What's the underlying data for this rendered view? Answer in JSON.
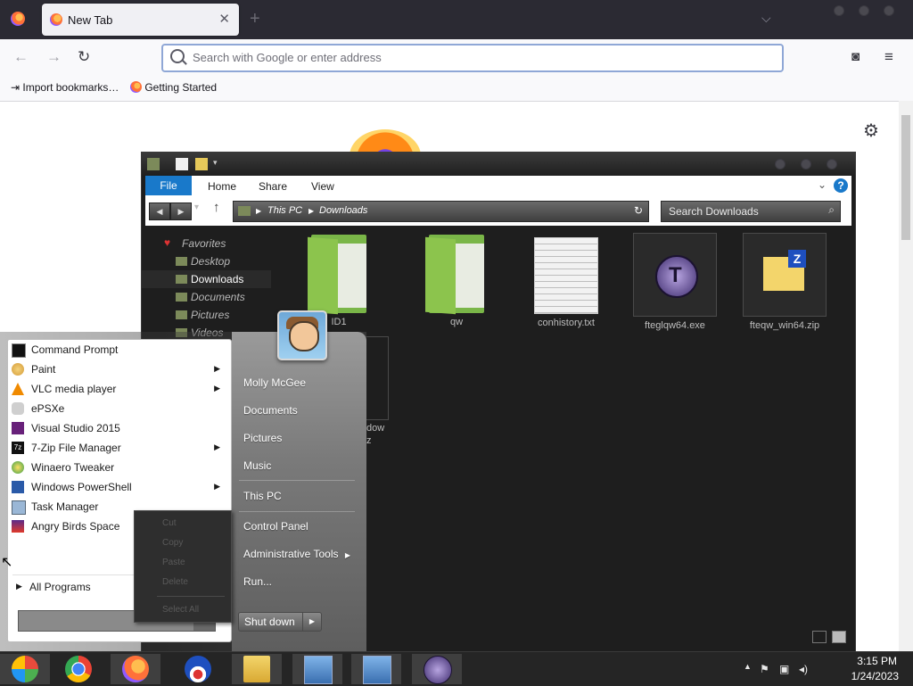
{
  "browser": {
    "tab_title": "New Tab",
    "address_placeholder": "Search with Google or enter address",
    "bookmarks": [
      "Import bookmarks…",
      "Getting Started"
    ]
  },
  "explorer": {
    "ribbon_tabs": [
      "File",
      "Home",
      "Share",
      "View"
    ],
    "breadcrumb": [
      "This PC",
      "Downloads"
    ],
    "search_placeholder": "Search Downloads",
    "nav_favorites": "Favorites",
    "nav_items": [
      "Desktop",
      "Downloads",
      "Documents",
      "Pictures",
      "Videos"
    ],
    "files": [
      {
        "name": "ID1",
        "type": "folder"
      },
      {
        "name": "qw",
        "type": "folder"
      },
      {
        "name": "conhistory.txt",
        "type": "text"
      },
      {
        "name": "fteglqw64.exe",
        "type": "exe"
      },
      {
        "name": "fteqw_win64.zip",
        "type": "zip"
      }
    ],
    "partial_file_label_1": "dow",
    "partial_file_label_2": "z"
  },
  "start_menu": {
    "programs": [
      {
        "label": "Command Prompt",
        "submenu": false,
        "icon": "cmd-icon"
      },
      {
        "label": "Paint",
        "submenu": true,
        "icon": "paint-icon"
      },
      {
        "label": "VLC media player",
        "submenu": true,
        "icon": "vlc-icon"
      },
      {
        "label": "ePSXe",
        "submenu": false,
        "icon": "gamepad-icon"
      },
      {
        "label": "Visual Studio 2015",
        "submenu": false,
        "icon": "visual-studio-icon"
      },
      {
        "label": "7-Zip File Manager",
        "submenu": true,
        "icon": "7zip-icon"
      },
      {
        "label": "Winaero Tweaker",
        "submenu": false,
        "icon": "winaero-icon"
      },
      {
        "label": "Windows PowerShell",
        "submenu": true,
        "icon": "powershell-icon"
      },
      {
        "label": "Task Manager",
        "submenu": false,
        "icon": "task-manager-icon"
      },
      {
        "label": "Angry Birds Space",
        "submenu": false,
        "icon": "angry-birds-icon"
      }
    ],
    "all_programs": "All Programs",
    "user_name": "Molly McGee",
    "right_items": [
      "Documents",
      "Pictures",
      "Music",
      "This PC",
      "Control Panel",
      "Administrative Tools",
      "Run..."
    ],
    "shutdown_label": "Shut down"
  },
  "context_menu": [
    "Cut",
    "Copy",
    "Paste",
    "Delete",
    "Select All"
  ],
  "taskbar": {
    "time": "3:15 PM",
    "date": "1/24/2023"
  }
}
